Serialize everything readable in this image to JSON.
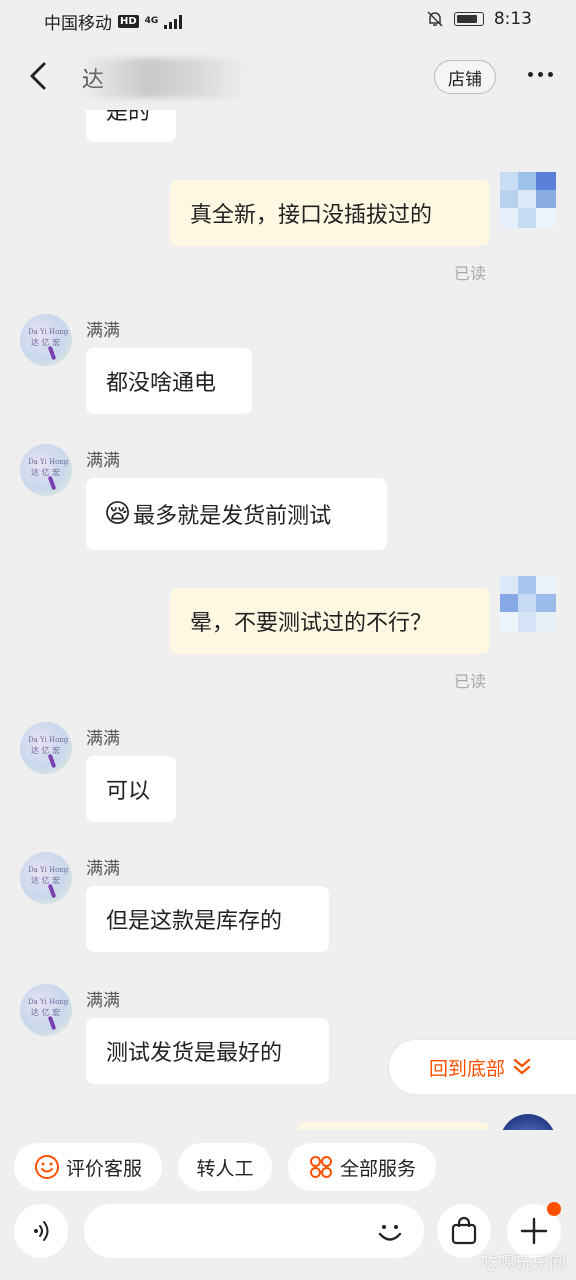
{
  "status_bar": {
    "carrier": "中国移动",
    "hd": "HD",
    "network": "4G",
    "time": "8:13"
  },
  "header": {
    "title": "达",
    "shop_button": "店铺"
  },
  "messages": [
    {
      "side": "in",
      "text": "是的"
    },
    {
      "side": "out",
      "text": "真全新，接口没插拔过的",
      "status": "已读"
    },
    {
      "side": "in",
      "sender": "满满",
      "text": "都没啥通电"
    },
    {
      "side": "in",
      "sender": "满满",
      "emoji": "😪",
      "text": "最多就是发货前测试"
    },
    {
      "side": "out",
      "text": "晕，不要测试过的不行？",
      "status": "已读"
    },
    {
      "side": "in",
      "sender": "满满",
      "text": "可以"
    },
    {
      "side": "in",
      "sender": "满满",
      "text": "但是这款是库存的"
    },
    {
      "side": "in",
      "sender": "满满",
      "text": "测试发货是最好的"
    }
  ],
  "avatar": {
    "line1": "Da Yi Hong",
    "line2": "达 亿 宏"
  },
  "back_to_bottom": "回到底部",
  "quick_actions": [
    {
      "label": "评价客服",
      "icon": "smiley-icon"
    },
    {
      "label": "转人工"
    },
    {
      "label": "全部服务",
      "icon": "grid-icon"
    }
  ],
  "input": {
    "placeholder": ""
  },
  "watermark": "吃喝玩乐网",
  "colors": {
    "accent": "#ff5000",
    "bubble_out": "#fef7e2",
    "background": "#efefef"
  }
}
